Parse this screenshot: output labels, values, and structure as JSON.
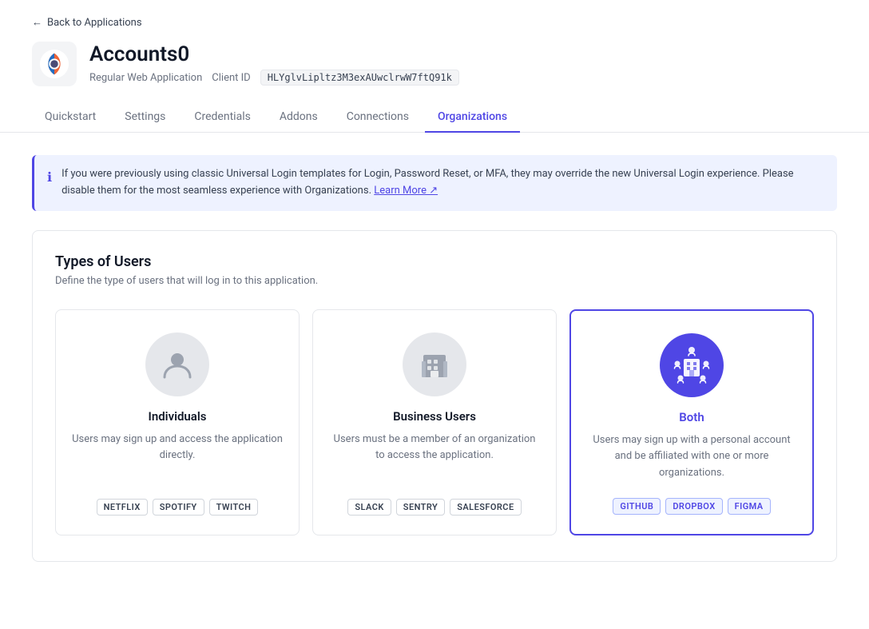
{
  "back_link": "Back to Applications",
  "app": {
    "name": "Accounts0",
    "type": "Regular Web Application",
    "client_id_label": "Client ID",
    "client_id_value": "HLYglvLipltz3M3exAUwclrwW7ftQ91k"
  },
  "tabs": [
    {
      "label": "Quickstart",
      "active": false
    },
    {
      "label": "Settings",
      "active": false
    },
    {
      "label": "Credentials",
      "active": false
    },
    {
      "label": "Addons",
      "active": false
    },
    {
      "label": "Connections",
      "active": false
    },
    {
      "label": "Organizations",
      "active": true
    }
  ],
  "banner": {
    "text": "If you were previously using classic Universal Login templates for Login, Password Reset, or MFA, they may override the new Universal Login experience. Please disable them for the most seamless experience with Organizations.",
    "link_text": "Learn More"
  },
  "card": {
    "title": "Types of Users",
    "subtitle": "Define the type of users that will log in to this application.",
    "user_types": [
      {
        "id": "individuals",
        "name": "Individuals",
        "desc": "Users may sign up and access the application directly.",
        "tags": [
          "NETFLIX",
          "SPOTIFY",
          "TWITCH"
        ],
        "selected": false
      },
      {
        "id": "business",
        "name": "Business Users",
        "desc": "Users must be a member of an organization to access the application.",
        "tags": [
          "SLACK",
          "SENTRY",
          "SALESFORCE"
        ],
        "selected": false
      },
      {
        "id": "both",
        "name": "Both",
        "desc": "Users may sign up with a personal account and be affiliated with one or more organizations.",
        "tags": [
          "GITHUB",
          "DROPBOX",
          "FIGMA"
        ],
        "selected": true
      }
    ]
  }
}
